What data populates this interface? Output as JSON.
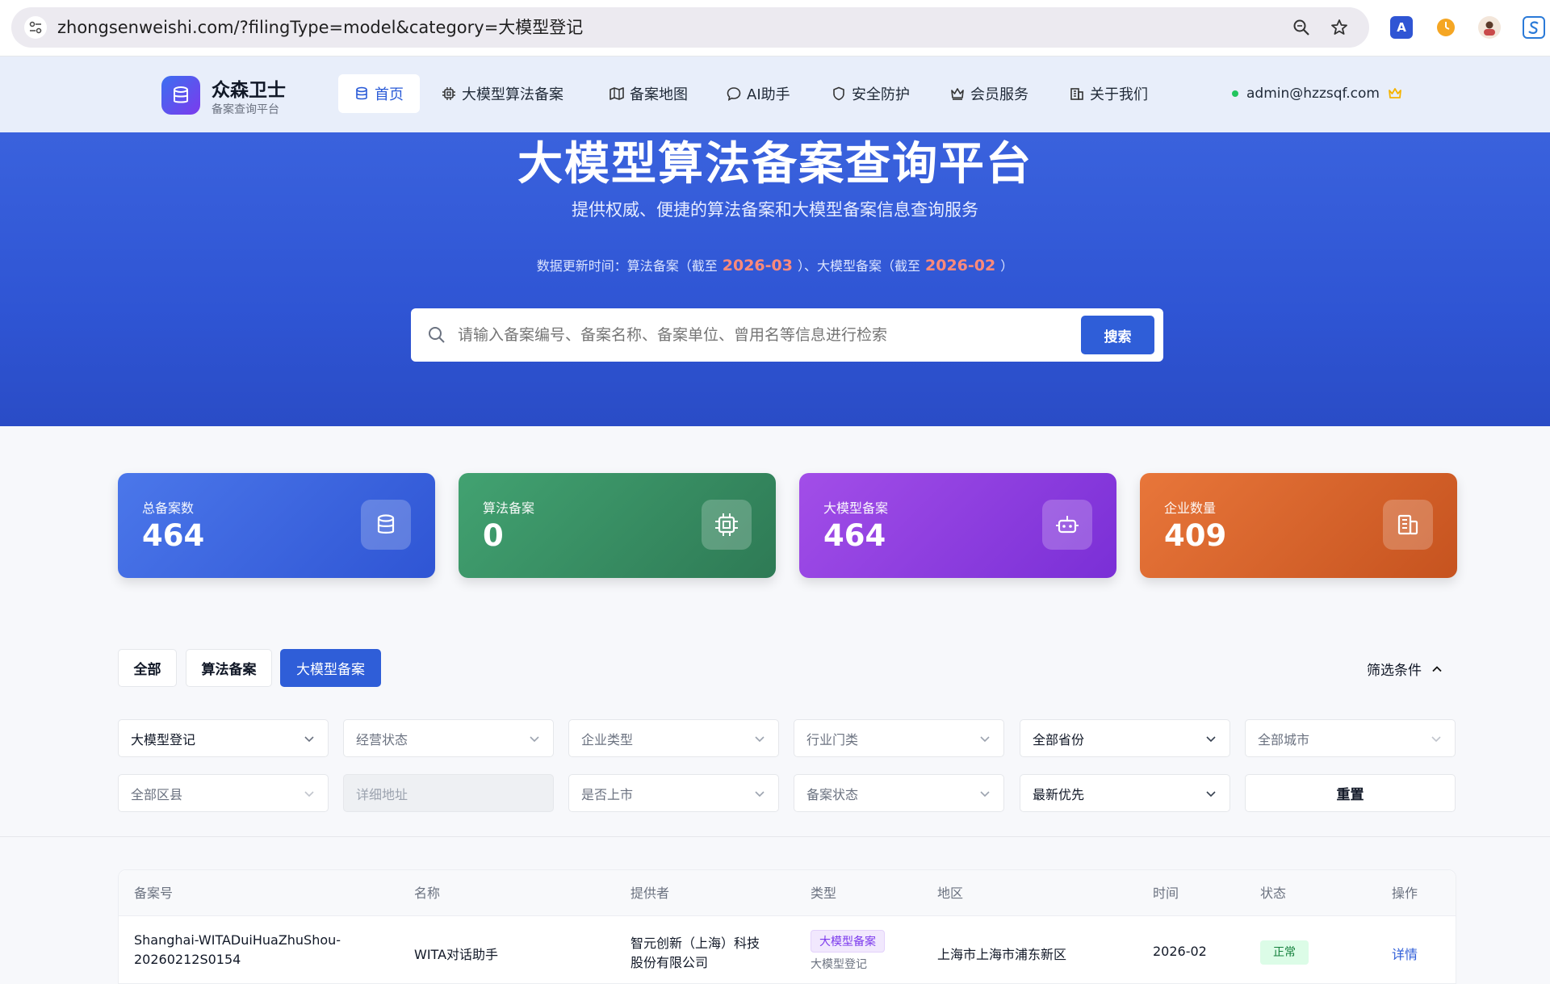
{
  "browser": {
    "url": "zhongsenweishi.com/?filingType=model&category=大模型登记"
  },
  "brand": {
    "title": "众森卫士",
    "subtitle": "备案查询平台"
  },
  "nav": {
    "items": [
      {
        "label": "首页"
      },
      {
        "label": "大模型算法备案"
      },
      {
        "label": "备案地图"
      },
      {
        "label": "AI助手"
      },
      {
        "label": "安全防护"
      },
      {
        "label": "会员服务"
      },
      {
        "label": "关于我们"
      }
    ],
    "user_email": "admin@hzzsqf.com"
  },
  "hero": {
    "title": "大模型算法备案查询平台",
    "subtitle": "提供权威、便捷的算法备案和大模型备案信息查询服务",
    "update_prefix": "数据更新时间：算法备案（截至",
    "algo_date": "2026-03",
    "update_mid": "）、大模型备案（截至",
    "model_date": "2026-02",
    "update_suffix": "）",
    "search_placeholder": "请输入备案编号、备案名称、备案单位、曾用名等信息进行检索",
    "search_button": "搜索"
  },
  "stats": [
    {
      "label": "总备案数",
      "value": "464",
      "icon": "database-icon",
      "color": "#3b6ff0"
    },
    {
      "label": "算法备案",
      "value": "0",
      "icon": "chip-icon",
      "color": "#3d9a6b"
    },
    {
      "label": "大模型备案",
      "value": "464",
      "icon": "robot-icon",
      "color": "#8b3fe4"
    },
    {
      "label": "企业数量",
      "value": "409",
      "icon": "building-icon",
      "color": "#de6a30"
    }
  ],
  "tabs": [
    {
      "label": "全部"
    },
    {
      "label": "算法备案"
    },
    {
      "label": "大模型备案"
    }
  ],
  "filter_toggle": "筛选条件",
  "filters": {
    "row1": [
      "大模型登记",
      "经营状态",
      "企业类型",
      "行业门类",
      "全部省份",
      "全部城市"
    ],
    "row2": [
      "全部区县",
      "详细地址",
      "是否上市",
      "备案状态",
      "最新优先",
      "重置"
    ]
  },
  "table": {
    "headers": [
      "备案号",
      "名称",
      "提供者",
      "类型",
      "地区",
      "时间",
      "状态",
      "操作"
    ],
    "rows": [
      {
        "id_line1": "Shanghai-WITADuiHuaZhuShou-",
        "id_line2": "20260212S0154",
        "name": "WITA对话助手",
        "provider_line1": "智元创新（上海）科技",
        "provider_line2": "股份有限公司",
        "type_badge": "大模型备案",
        "type_sub": "大模型登记",
        "region": "上海市上海市浦东新区",
        "time": "2026-02",
        "status": "正常",
        "action": "详情"
      }
    ]
  }
}
